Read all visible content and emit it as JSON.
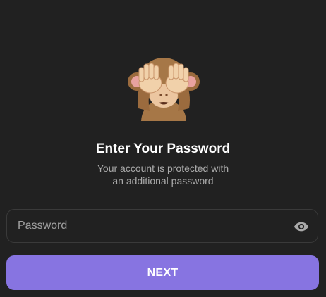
{
  "auth": {
    "title": "Enter Your Password",
    "subtitle_lines": [
      "Your account is protected with",
      "an additional password"
    ],
    "password_field": {
      "placeholder": "Password",
      "value": ""
    },
    "next_label": "NEXT"
  },
  "icons": {
    "hero": "see-no-evil-monkey-icon",
    "toggle_visibility": "eye-icon"
  },
  "colors": {
    "background": "#212121",
    "accent": "#8774e1",
    "title": "#ffffff",
    "secondary_text": "#aaaaaa",
    "field_border": "#3a3a3a",
    "icon": "#aaaaaa"
  }
}
